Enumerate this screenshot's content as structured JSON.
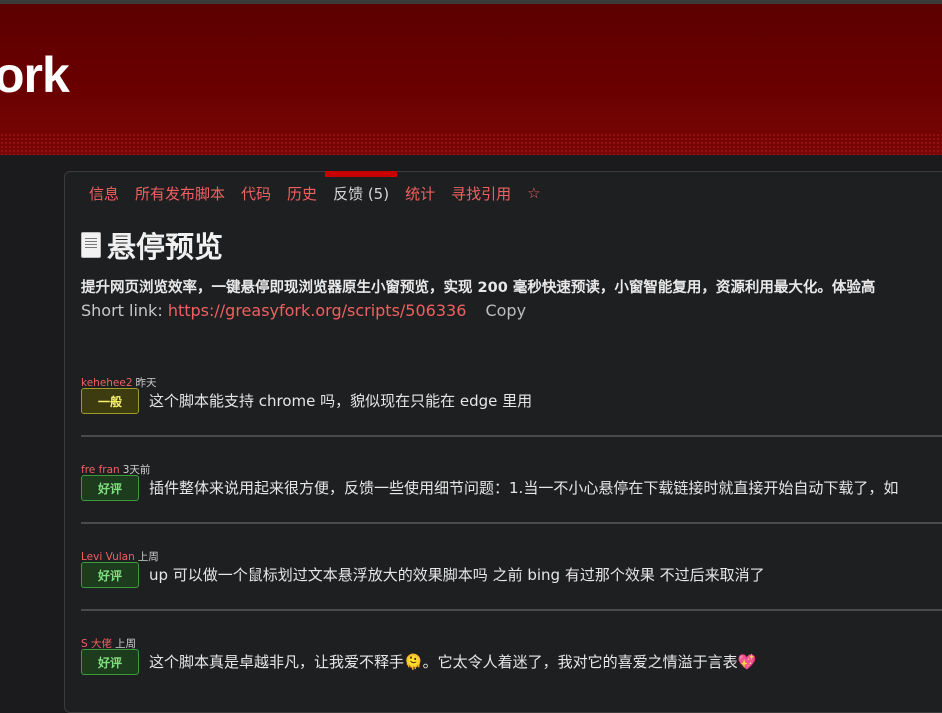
{
  "header": {
    "logo_text": "ork"
  },
  "nav": {
    "items": [
      {
        "label": "信息"
      },
      {
        "label": "所有发布脚本"
      },
      {
        "label": "代码"
      },
      {
        "label": "历史"
      },
      {
        "label": "反馈 (5)"
      },
      {
        "label": "统计"
      },
      {
        "label": "寻找引用"
      },
      {
        "label": "☆"
      }
    ],
    "current_index": 4
  },
  "script": {
    "title": "悬停预览",
    "description": "提升网页浏览效率，一键悬停即现浏览器原生小窗预览，实现 200 毫秒快速预读，小窗智能复用，资源利用最大化。体验高",
    "short_link_label": "Short link:",
    "short_link_url": "https://greasyfork.org/scripts/506336",
    "copy_label": "Copy"
  },
  "feedback": [
    {
      "user": "kehehee2",
      "time": "昨天",
      "rating": "一般",
      "text": "这个脚本能支持 chrome 吗，貌似现在只能在 edge 里用"
    },
    {
      "user": "fre fran",
      "time": "3天前",
      "rating": "好评",
      "text": "插件整体来说用起来很方便，反馈一些使用细节问题：1.当一不小心悬停在下载链接时就直接开始自动下载了，如"
    },
    {
      "user": "Levi Vulan",
      "time": "上周",
      "rating": "好评",
      "text": "up 可以做一个鼠标划过文本悬浮放大的效果脚本吗 之前 bing 有过那个效果 不过后来取消了"
    },
    {
      "user": "S 大佬",
      "time": "上周",
      "rating": "好评",
      "text": "这个脚本真是卓越非凡，让我爱不释手🫠。它太令人着迷了，我对它的喜爱之情溢于言表💖"
    }
  ],
  "colors": {
    "accent": "#f06060",
    "header_bg": "#6a0000",
    "rating_ok": "#f4f06a",
    "rating_good": "#7ee07e"
  }
}
